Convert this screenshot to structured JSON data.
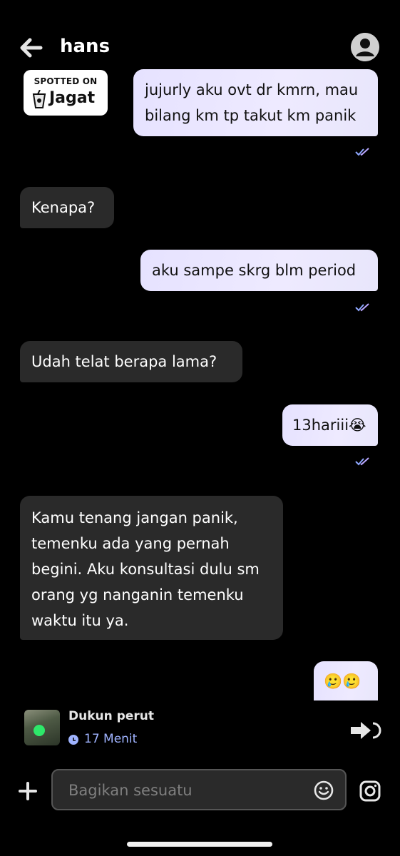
{
  "header": {
    "title": "hans"
  },
  "badge": {
    "line1": "SPOTTED ON",
    "line2": "Jagat"
  },
  "messages": [
    {
      "dir": "out",
      "lines": [
        "jujurly aku ovt dr kmrn, mau",
        "bilang km tp takut km panik"
      ]
    },
    {
      "dir": "in",
      "lines": [
        "Kenapa?"
      ]
    },
    {
      "dir": "out",
      "lines": [
        "aku sampe skrg blm period"
      ]
    },
    {
      "dir": "in",
      "lines": [
        "Udah telat berapa lama?"
      ]
    },
    {
      "dir": "out",
      "lines": [
        "13hariii😭"
      ]
    },
    {
      "dir": "in",
      "lines": [
        "Kamu tenang jangan panik,",
        "temenku ada yang pernah",
        "begini. Aku konsultasi dulu sm",
        "orang yg nanganin temenku",
        "waktu itu ya."
      ]
    },
    {
      "dir": "out",
      "lines": [
        "🥲🥲"
      ]
    }
  ],
  "status": {
    "name": "Dukun perut",
    "time": "17 Menit"
  },
  "composer": {
    "placeholder": "Bagikan sesuatu"
  },
  "colors": {
    "outgoing_bubble": "#e9e5ff",
    "incoming_bubble": "#2a2a2a",
    "tick": "#8fa8ff",
    "time_accent": "#9fb3ff"
  }
}
